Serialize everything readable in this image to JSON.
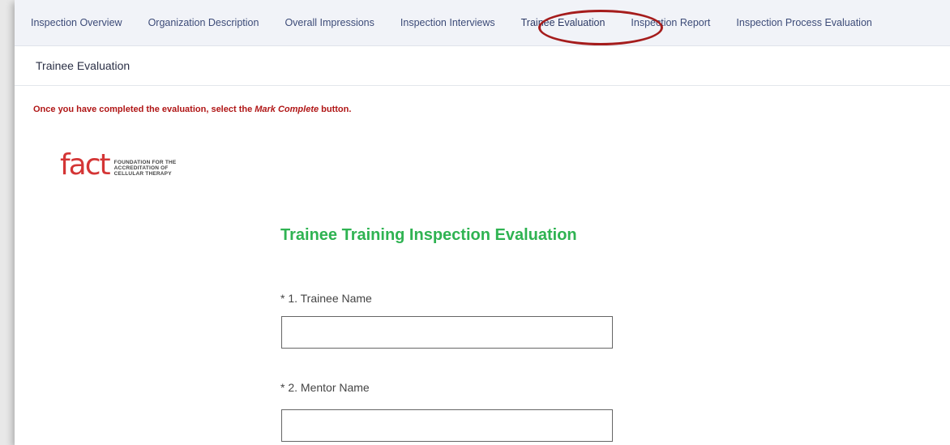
{
  "tabs": [
    {
      "label": "Inspection Overview"
    },
    {
      "label": "Organization Description"
    },
    {
      "label": "Overall Impressions"
    },
    {
      "label": "Inspection Interviews"
    },
    {
      "label": "Trainee Evaluation"
    },
    {
      "label": "Inspection Report"
    },
    {
      "label": "Inspection Process Evaluation"
    }
  ],
  "section": {
    "title": "Trainee Evaluation"
  },
  "instruction": {
    "prefix": "Once you have completed the evaluation, select the ",
    "emphasis": "Mark Complete",
    "suffix": " button."
  },
  "logo": {
    "mark": "fact",
    "line1": "FOUNDATION FOR THE",
    "line2": "ACCREDITATION OF",
    "line3": "CELLULAR THERAPY"
  },
  "form": {
    "title": "Trainee Training Inspection Evaluation",
    "q1_label": "* 1. Trainee Name",
    "q1_value": "",
    "q2_label": "* 2. Mentor Name",
    "q2_value": ""
  },
  "colors": {
    "tab_text": "#3c4b78",
    "highlight_circle": "#a51c1c",
    "instruction": "#b01616",
    "form_title": "#2fb352",
    "logo": "#d43535"
  }
}
